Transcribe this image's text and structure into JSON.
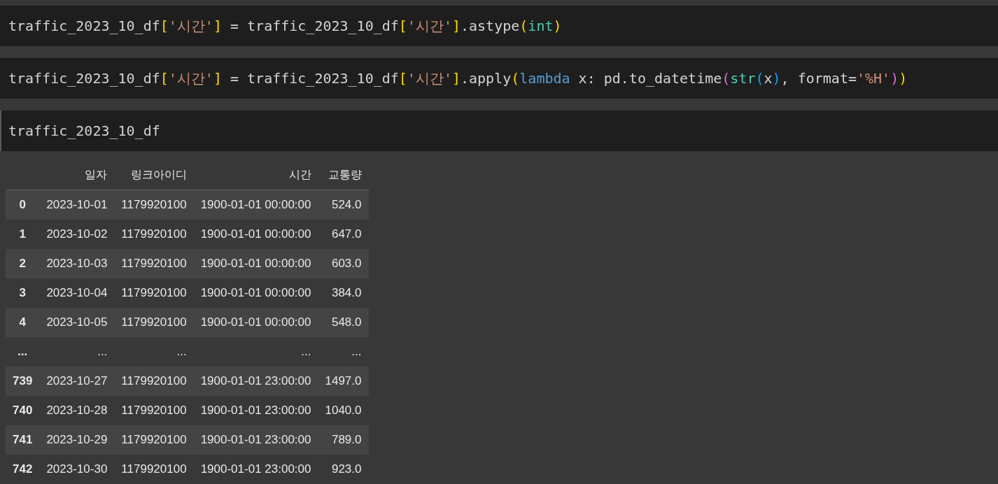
{
  "cells": [
    {
      "tokens": [
        {
          "kind": "plain",
          "text": "traffic_2023_10_df"
        },
        {
          "kind": "bracket",
          "text": "["
        },
        {
          "kind": "string",
          "text": "'시간'"
        },
        {
          "kind": "bracket",
          "text": "]"
        },
        {
          "kind": "plain",
          "text": " = traffic_2023_10_df"
        },
        {
          "kind": "bracket",
          "text": "["
        },
        {
          "kind": "string",
          "text": "'시간'"
        },
        {
          "kind": "bracket",
          "text": "]"
        },
        {
          "kind": "plain",
          "text": ".astype"
        },
        {
          "kind": "bracket",
          "text": "("
        },
        {
          "kind": "builtin",
          "text": "int"
        },
        {
          "kind": "bracket",
          "text": ")"
        }
      ]
    },
    {
      "tokens": [
        {
          "kind": "plain",
          "text": "traffic_2023_10_df"
        },
        {
          "kind": "bracket",
          "text": "["
        },
        {
          "kind": "string",
          "text": "'시간'"
        },
        {
          "kind": "bracket",
          "text": "]"
        },
        {
          "kind": "plain",
          "text": " = traffic_2023_10_df"
        },
        {
          "kind": "bracket",
          "text": "["
        },
        {
          "kind": "string",
          "text": "'시간'"
        },
        {
          "kind": "bracket",
          "text": "]"
        },
        {
          "kind": "plain",
          "text": ".apply"
        },
        {
          "kind": "bracket",
          "text": "("
        },
        {
          "kind": "keyword",
          "text": "lambda"
        },
        {
          "kind": "plain",
          "text": " x: pd.to_datetime"
        },
        {
          "kind": "bracket2",
          "text": "("
        },
        {
          "kind": "builtin",
          "text": "str"
        },
        {
          "kind": "bracket3",
          "text": "("
        },
        {
          "kind": "plain",
          "text": "x"
        },
        {
          "kind": "bracket3",
          "text": ")"
        },
        {
          "kind": "plain",
          "text": ", format="
        },
        {
          "kind": "string",
          "text": "'%H'"
        },
        {
          "kind": "bracket2",
          "text": ")"
        },
        {
          "kind": "bracket",
          "text": ")"
        }
      ]
    },
    {
      "tokens": [
        {
          "kind": "plain",
          "text": "traffic_2023_10_df"
        }
      ]
    }
  ],
  "table": {
    "columns": [
      "일자",
      "링크아이디",
      "시간",
      "교통량"
    ],
    "rows": [
      {
        "index": "0",
        "cells": [
          "2023-10-01",
          "1179920100",
          "1900-01-01 00:00:00",
          "524.0"
        ]
      },
      {
        "index": "1",
        "cells": [
          "2023-10-02",
          "1179920100",
          "1900-01-01 00:00:00",
          "647.0"
        ]
      },
      {
        "index": "2",
        "cells": [
          "2023-10-03",
          "1179920100",
          "1900-01-01 00:00:00",
          "603.0"
        ]
      },
      {
        "index": "3",
        "cells": [
          "2023-10-04",
          "1179920100",
          "1900-01-01 00:00:00",
          "384.0"
        ]
      },
      {
        "index": "4",
        "cells": [
          "2023-10-05",
          "1179920100",
          "1900-01-01 00:00:00",
          "548.0"
        ]
      },
      {
        "index": "...",
        "cells": [
          "...",
          "...",
          "...",
          "..."
        ]
      },
      {
        "index": "739",
        "cells": [
          "2023-10-27",
          "1179920100",
          "1900-01-01 23:00:00",
          "1497.0"
        ]
      },
      {
        "index": "740",
        "cells": [
          "2023-10-28",
          "1179920100",
          "1900-01-01 23:00:00",
          "1040.0"
        ]
      },
      {
        "index": "741",
        "cells": [
          "2023-10-29",
          "1179920100",
          "1900-01-01 23:00:00",
          "789.0"
        ]
      },
      {
        "index": "742",
        "cells": [
          "2023-10-30",
          "1179920100",
          "1900-01-01 23:00:00",
          "923.0"
        ]
      }
    ]
  }
}
